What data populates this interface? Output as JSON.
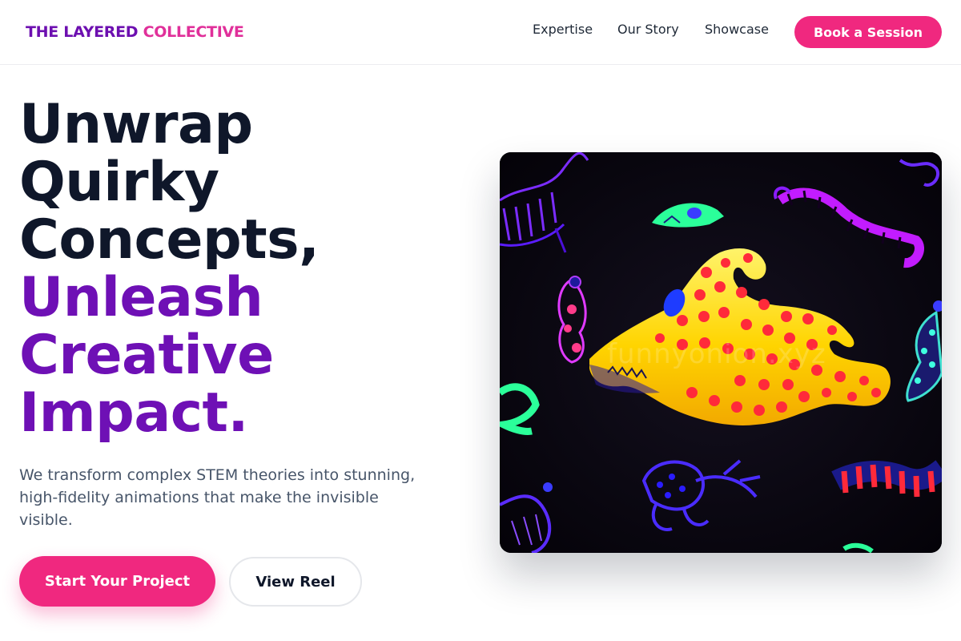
{
  "header": {
    "logo_part1": "THE LAYERED",
    "logo_part2": "COLLECTIVE",
    "nav": [
      "Expertise",
      "Our Story",
      "Showcase"
    ],
    "cta_label": "Book a Session"
  },
  "hero": {
    "headline_lines_dark": [
      "Unwrap",
      "Quirky",
      "Concepts,"
    ],
    "headline_lines_accent": [
      "Unleash",
      "Creative",
      "Impact."
    ],
    "subtext": "We transform complex STEM theories into stunning, high-fidelity animations that make the invisible visible.",
    "primary_cta": "Start Your Project",
    "secondary_cta": "View Reel",
    "image_watermark": "funnyonion.xyz"
  },
  "colors": {
    "brand_purple": "#6e10b5",
    "brand_pink": "#f0287f",
    "text_dark": "#0f172a",
    "text_muted": "#475569"
  }
}
